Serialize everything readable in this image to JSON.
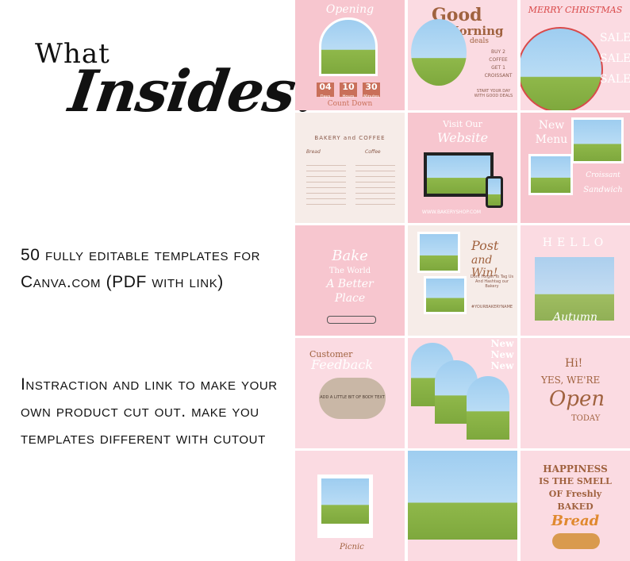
{
  "heading": {
    "line1": "What",
    "line2": "Insides?"
  },
  "features": [
    "50 fully editable templates for Canva.com (PDF with link)",
    "Instraction and link to make your own product cut out. make you templates different with cutout"
  ],
  "templates": {
    "opening": {
      "title": "Opening",
      "days": "04",
      "days_label": "Days",
      "hours": "10",
      "hours_label": "Hours",
      "minutes": "30",
      "minutes_label": "Minutes",
      "footer": "Count Down"
    },
    "good_morning": {
      "title": "Good",
      "title2": "Morning",
      "sub": "deals",
      "offer1": "BUY 2",
      "offer2": "COFFEE",
      "offer3": "GET 1",
      "offer4": "CROISSANT",
      "tagline": "START YOUR DAY WITH GOOD DEALS"
    },
    "christmas": {
      "title": "MERRY CHRISTMAS",
      "sale": "SALE"
    },
    "menu": {
      "title": "BAKERY and COFFEE",
      "col1": "Bread",
      "col2": "Coffee"
    },
    "website": {
      "title": "Visit Our",
      "title2": "Website",
      "url": "WWW.BAKERYSHOP.COM"
    },
    "new_menu": {
      "title": "New",
      "title2": "Menu",
      "item1": "Croissant",
      "item2": "Sandwich"
    },
    "bake": {
      "line1": "Bake",
      "line2": "The World",
      "line3": "A Better",
      "line4": "Place"
    },
    "post_win": {
      "title": "Post",
      "title2": "and Win!",
      "sub": "Dont Forget To Tag Us And Hashtag our Bakery",
      "hashtag": "#YOURBAKERYNAME"
    },
    "hello": {
      "title": "HELLO",
      "sub": "Autumn"
    },
    "feedback": {
      "title": "Customer",
      "title2": "Feedback",
      "body": "ADD A LITTLE BIT OF BODY TEXT"
    },
    "new": {
      "label": "New"
    },
    "open": {
      "hi": "Hi!",
      "line": "YES, WE'RE",
      "open": "Open",
      "today": "TODAY"
    },
    "picnic": {
      "title": "Picnic"
    },
    "happiness": {
      "line1": "HAPPINESS",
      "line2": "IS THE SMELL",
      "line3": "OF Freshly",
      "line4": "BAKED",
      "line5": "Bread"
    }
  },
  "colors": {
    "pink": "#f7c6cf",
    "brown": "#a0623f",
    "accent": "#c9705a"
  }
}
